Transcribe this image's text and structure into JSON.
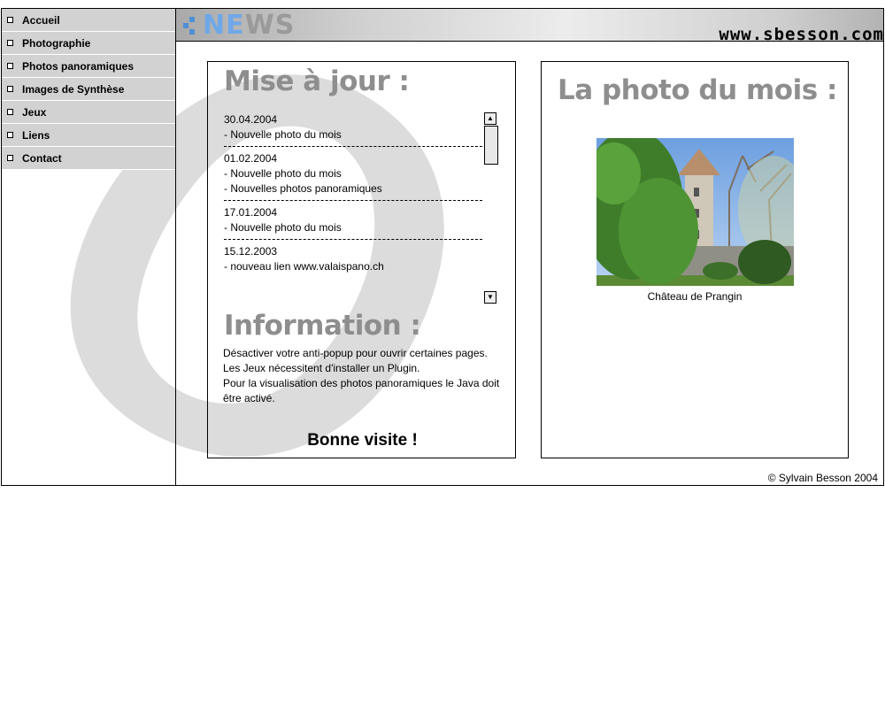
{
  "sidebar": {
    "items": [
      {
        "label": "Accueil"
      },
      {
        "label": "Photographie"
      },
      {
        "label": "Photos panoramiques"
      },
      {
        "label": "Images de Synthèse"
      },
      {
        "label": "Jeux"
      },
      {
        "label": "Liens"
      },
      {
        "label": "Contact"
      }
    ]
  },
  "header": {
    "logo_part1": "NE",
    "logo_part2": "WS",
    "site_url": "www.sbesson.com"
  },
  "updates_panel": {
    "title": "Mise à jour :",
    "entries": [
      {
        "date": "30.04.2004",
        "lines": [
          "- Nouvelle photo du mois"
        ]
      },
      {
        "date": "01.02.2004",
        "lines": [
          "- Nouvelle photo du mois",
          "- Nouvelles photos panoramiques"
        ]
      },
      {
        "date": "17.01.2004",
        "lines": [
          "- Nouvelle photo du mois"
        ]
      },
      {
        "date": "15.12.2003",
        "lines": [
          "- nouveau lien www.valaispano.ch"
        ]
      }
    ],
    "info_title": "Information :",
    "info_lines": [
      "Désactiver votre anti-popup pour ouvrir certaines  pages.",
      "Les Jeux nécessitent d'installer un Plugin.",
      "Pour la visualisation des photos panoramiques le Java doit être activé."
    ],
    "greeting": "Bonne visite !"
  },
  "photo_panel": {
    "title": "La photo du mois :",
    "caption": "Château de Prangin"
  },
  "footer": {
    "copyright": "© Sylvain Besson 2004"
  },
  "colors": {
    "nav_bg": "#d2d2d2",
    "title_gray": "#8e8e8e",
    "logo_blue": "#6fa8e8",
    "swirl_gray": "#dcdcdc"
  }
}
